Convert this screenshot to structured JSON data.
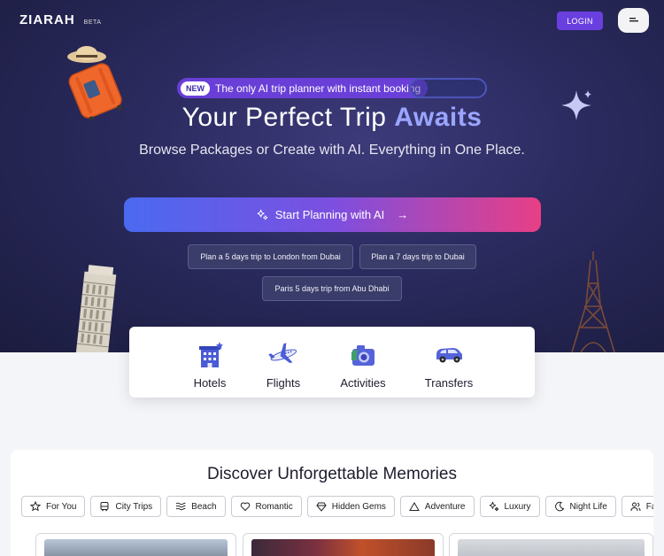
{
  "header": {
    "logo_text": "ZIARAH",
    "beta_label": "BETA",
    "login_label": "LOGIN",
    "menu_icon": "menu-icon"
  },
  "hero": {
    "new_badge": "NEW",
    "announcement": "The only AI trip planner with instant booking",
    "title_main": "Your Perfect Trip",
    "title_accent": "Awaits",
    "subtitle": "Browse Packages or Create with AI. Everything in One Place.",
    "cta_label": "Start Planning with AI",
    "cta_icon": "sparkles-icon",
    "cta_arrow": "→",
    "suggestions": [
      "Plan a 5 days trip to London from Dubai",
      "Plan a 7 days trip to Dubai",
      "Paris 5 days trip from Abu Dhabi"
    ]
  },
  "categories": [
    {
      "label": "Hotels",
      "icon": "hotel-icon"
    },
    {
      "label": "Flights",
      "icon": "airplane-icon"
    },
    {
      "label": "Activities",
      "icon": "camera-icon"
    },
    {
      "label": "Transfers",
      "icon": "car-icon"
    }
  ],
  "memories": {
    "title": "Discover Unforgettable Memories",
    "filters": [
      {
        "label": "For You",
        "icon": "star-icon"
      },
      {
        "label": "City Trips",
        "icon": "bus-icon"
      },
      {
        "label": "Beach",
        "icon": "waves-icon"
      },
      {
        "label": "Romantic",
        "icon": "heart-icon"
      },
      {
        "label": "Hidden Gems",
        "icon": "gem-icon"
      },
      {
        "label": "Adventure",
        "icon": "mountain-icon"
      },
      {
        "label": "Luxury",
        "icon": "sparkles-icon"
      },
      {
        "label": "Night Life",
        "icon": "moon-icon"
      },
      {
        "label": "Family",
        "icon": "users-icon"
      }
    ]
  },
  "colors": {
    "brand_purple": "#6a3fe0",
    "cta_start": "#4a6af0",
    "cta_end": "#e83f85",
    "accent_text": "#9aa5ff"
  }
}
